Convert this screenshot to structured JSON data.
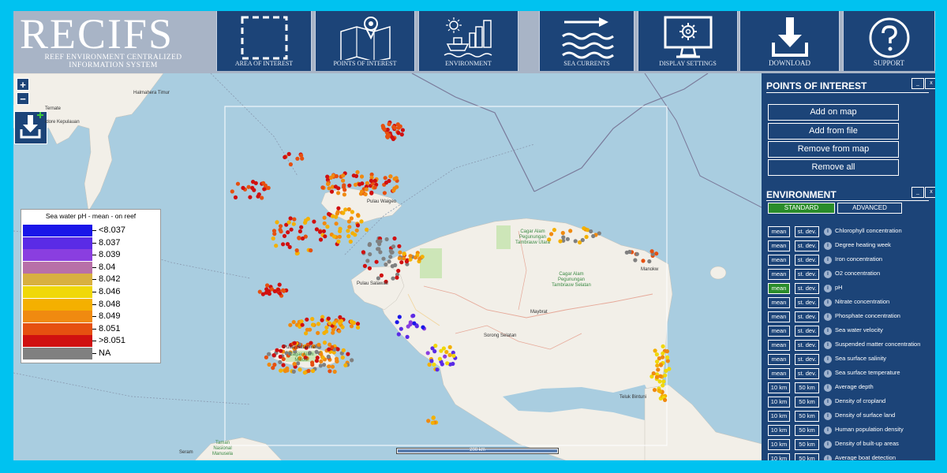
{
  "app": {
    "logo_title": "RECIFS",
    "logo_sub1": "REEF ENVIRONMENT CENTRALIZED",
    "logo_sub2": "INFORMATION SYSTEM"
  },
  "nav": [
    {
      "label": "AREA OF INTEREST",
      "icon": "dashed-square-icon"
    },
    {
      "label": "POINTS OF INTEREST",
      "icon": "map-pin-icon"
    },
    {
      "label": "ENVIRONMENT",
      "icon": "sun-ship-city-icon"
    },
    {
      "label": "SEA CURRENTS",
      "icon": "waves-arrow-icon"
    },
    {
      "label": "DISPLAY SETTINGS",
      "icon": "monitor-gear-icon"
    },
    {
      "label": "DOWNLOAD",
      "icon": "download-icon"
    },
    {
      "label": "SUPPORT",
      "icon": "question-icon"
    }
  ],
  "map": {
    "zoom_in": "+",
    "zoom_out": "−",
    "scale_label": "200 km",
    "places": {
      "ternate": "Ternate",
      "kepulauan": "idore Kepulauan",
      "halmahera": "Halmahera Timur",
      "waigeo": "Pulau Waigeo",
      "salawati": "Pulau Salawati",
      "batanme": "Pulau Batanme",
      "misool": "Cagar Alam Misool",
      "tambrauw_utara": "Cagar Alam Pegunungan Tambrauw Utara",
      "tambrauw_selatan": "Cagar Alam Pegunungan Tambrauw Selatan",
      "sorong": "Sorong Selatan",
      "maybrat": "Maybrat",
      "bintuni": "Teluk Bintuni",
      "manokwari": "Manokw",
      "seram": "Seram",
      "manusela": "Taman Nasional Manusela"
    }
  },
  "legend": {
    "title": "Sea water pH - mean - on reef",
    "items": [
      {
        "label": "<8.037",
        "color": "#1a16e8"
      },
      {
        "label": "8.037",
        "color": "#5a2be6"
      },
      {
        "label": "8.039",
        "color": "#8a3ee0"
      },
      {
        "label": "8.04",
        "color": "#b870a8"
      },
      {
        "label": "8.042",
        "color": "#d8b040"
      },
      {
        "label": "8.046",
        "color": "#f0d808"
      },
      {
        "label": "8.048",
        "color": "#f4b000"
      },
      {
        "label": "8.049",
        "color": "#f08a10"
      },
      {
        "label": "8.051",
        "color": "#e65010"
      },
      {
        "label": ">8.051",
        "color": "#d01010"
      },
      {
        "label": "NA",
        "color": "#808080"
      }
    ]
  },
  "poi": {
    "title": "POINTS OF INTEREST",
    "buttons": [
      "Add on map",
      "Add from file",
      "Remove from map",
      "Remove all"
    ]
  },
  "env": {
    "title": "ENVIRONMENT",
    "tab_standard": "STANDARD",
    "tab_advanced": "ADVANCED",
    "rows": [
      {
        "b1": "mean",
        "b2": "st. dev.",
        "label": "Chlorophyll concentration",
        "active": false
      },
      {
        "b1": "mean",
        "b2": "st. dev.",
        "label": "Degree heating week",
        "active": false
      },
      {
        "b1": "mean",
        "b2": "st. dev.",
        "label": "Iron concentration",
        "active": false
      },
      {
        "b1": "mean",
        "b2": "st. dev.",
        "label": "O2 concentration",
        "active": false
      },
      {
        "b1": "mean",
        "b2": "st. dev.",
        "label": "pH",
        "active": true
      },
      {
        "b1": "mean",
        "b2": "st. dev.",
        "label": "Nitrate concentration",
        "active": false
      },
      {
        "b1": "mean",
        "b2": "st. dev.",
        "label": "Phosphate concentration",
        "active": false
      },
      {
        "b1": "mean",
        "b2": "st. dev.",
        "label": "Sea water velocity",
        "active": false
      },
      {
        "b1": "mean",
        "b2": "st. dev.",
        "label": "Suspended matter concentration",
        "active": false
      },
      {
        "b1": "mean",
        "b2": "st. dev.",
        "label": "Sea surface salinity",
        "active": false
      },
      {
        "b1": "mean",
        "b2": "st. dev.",
        "label": "Sea surface temperature",
        "active": false
      },
      {
        "b1": "10 km",
        "b2": "50 km",
        "label": "Average depth",
        "active": false
      },
      {
        "b1": "10 km",
        "b2": "50 km",
        "label": "Density of cropland",
        "active": false
      },
      {
        "b1": "10 km",
        "b2": "50 km",
        "label": "Density of surface land",
        "active": false
      },
      {
        "b1": "10 km",
        "b2": "50 km",
        "label": "Human population density",
        "active": false
      },
      {
        "b1": "10 km",
        "b2": "50 km",
        "label": "Density of built-up areas",
        "active": false
      },
      {
        "b1": "10 km",
        "b2": "50 km",
        "label": "Average boat detection",
        "active": false
      }
    ]
  },
  "panel_controls": {
    "minimize": "_",
    "close": "x"
  }
}
